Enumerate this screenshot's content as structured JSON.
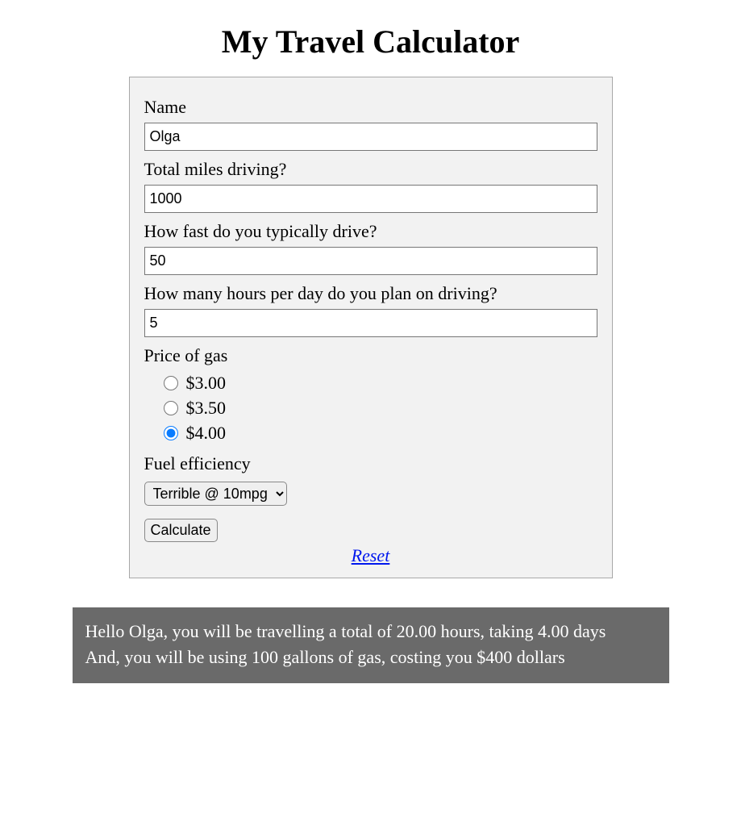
{
  "title": "My Travel Calculator",
  "form": {
    "name": {
      "label": "Name",
      "value": "Olga"
    },
    "miles": {
      "label": "Total miles driving?",
      "value": "1000"
    },
    "speed": {
      "label": "How fast do you typically drive?",
      "value": "50"
    },
    "hours": {
      "label": "How many hours per day do you plan on driving?",
      "value": "5"
    },
    "gas": {
      "label": "Price of gas",
      "options": [
        {
          "label": "$3.00",
          "checked": false
        },
        {
          "label": "$3.50",
          "checked": false
        },
        {
          "label": "$4.00",
          "checked": true
        }
      ]
    },
    "efficiency": {
      "label": "Fuel efficiency",
      "selected": "Terrible @ 10mpg"
    },
    "calculate": "Calculate",
    "reset": "Reset"
  },
  "result": {
    "line1": "Hello Olga, you will be travelling a total of 20.00 hours, taking 4.00 days",
    "line2": "And, you will be using 100 gallons of gas, costing you $400 dollars"
  }
}
